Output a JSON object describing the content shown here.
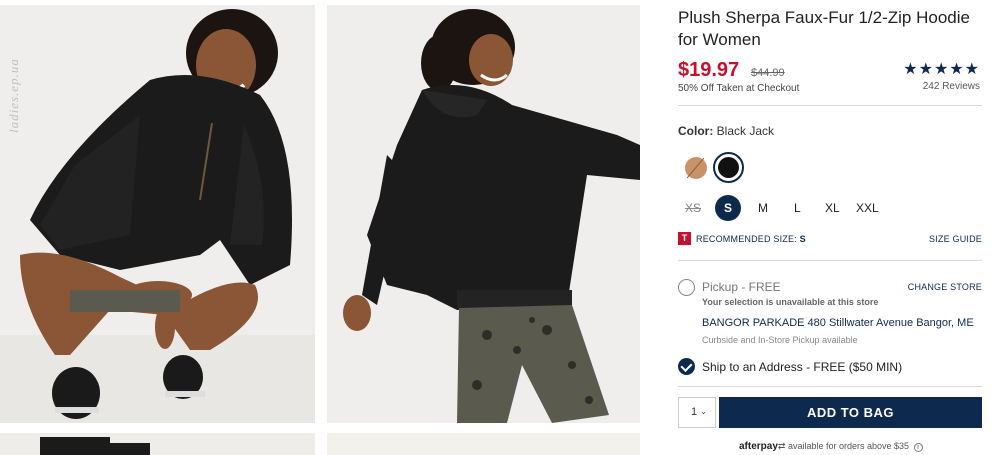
{
  "watermark": "ladies.ep.ua",
  "product": {
    "title": "Plush Sherpa Faux-Fur 1/2-Zip Hoodie for Women",
    "price": "$19.97",
    "original_price": "$44.99",
    "promo": "50% Off Taken at Checkout",
    "rating": 4.5,
    "rating_stars": "★★★★★",
    "reviews": "242 Reviews"
  },
  "color": {
    "label": "Color:",
    "selected": "Black Jack",
    "swatches": [
      {
        "name": "tan",
        "hex": "#c8936a",
        "available": false
      },
      {
        "name": "Black Jack",
        "hex": "#111111",
        "available": true,
        "selected": true
      }
    ]
  },
  "sizes": {
    "options": [
      "XS",
      "S",
      "M",
      "L",
      "XL",
      "XXL"
    ],
    "selected": "S",
    "unavailable": [
      "XS"
    ]
  },
  "recommended": {
    "icon": "T",
    "text": "RECOMMENDED SIZE:",
    "size": "S",
    "guide_label": "SIZE GUIDE"
  },
  "pickup": {
    "label": "Pickup - FREE",
    "change_store": "CHANGE STORE",
    "unavailable_msg": "Your selection is unavailable at this store",
    "store": "BANGOR PARKADE 480 Stillwater Avenue  Bangor, ME",
    "curbside": "Curbside and In-Store Pickup available"
  },
  "ship": {
    "label": "Ship to an Address - FREE ($50 MIN)"
  },
  "cart": {
    "quantity": "1",
    "add_label": "ADD TO BAG"
  },
  "afterpay": {
    "brand": "afterpay",
    "text": "available for orders above $35"
  },
  "colors": {
    "navy": "#0d2a4e",
    "sale_red": "#c8102e"
  }
}
